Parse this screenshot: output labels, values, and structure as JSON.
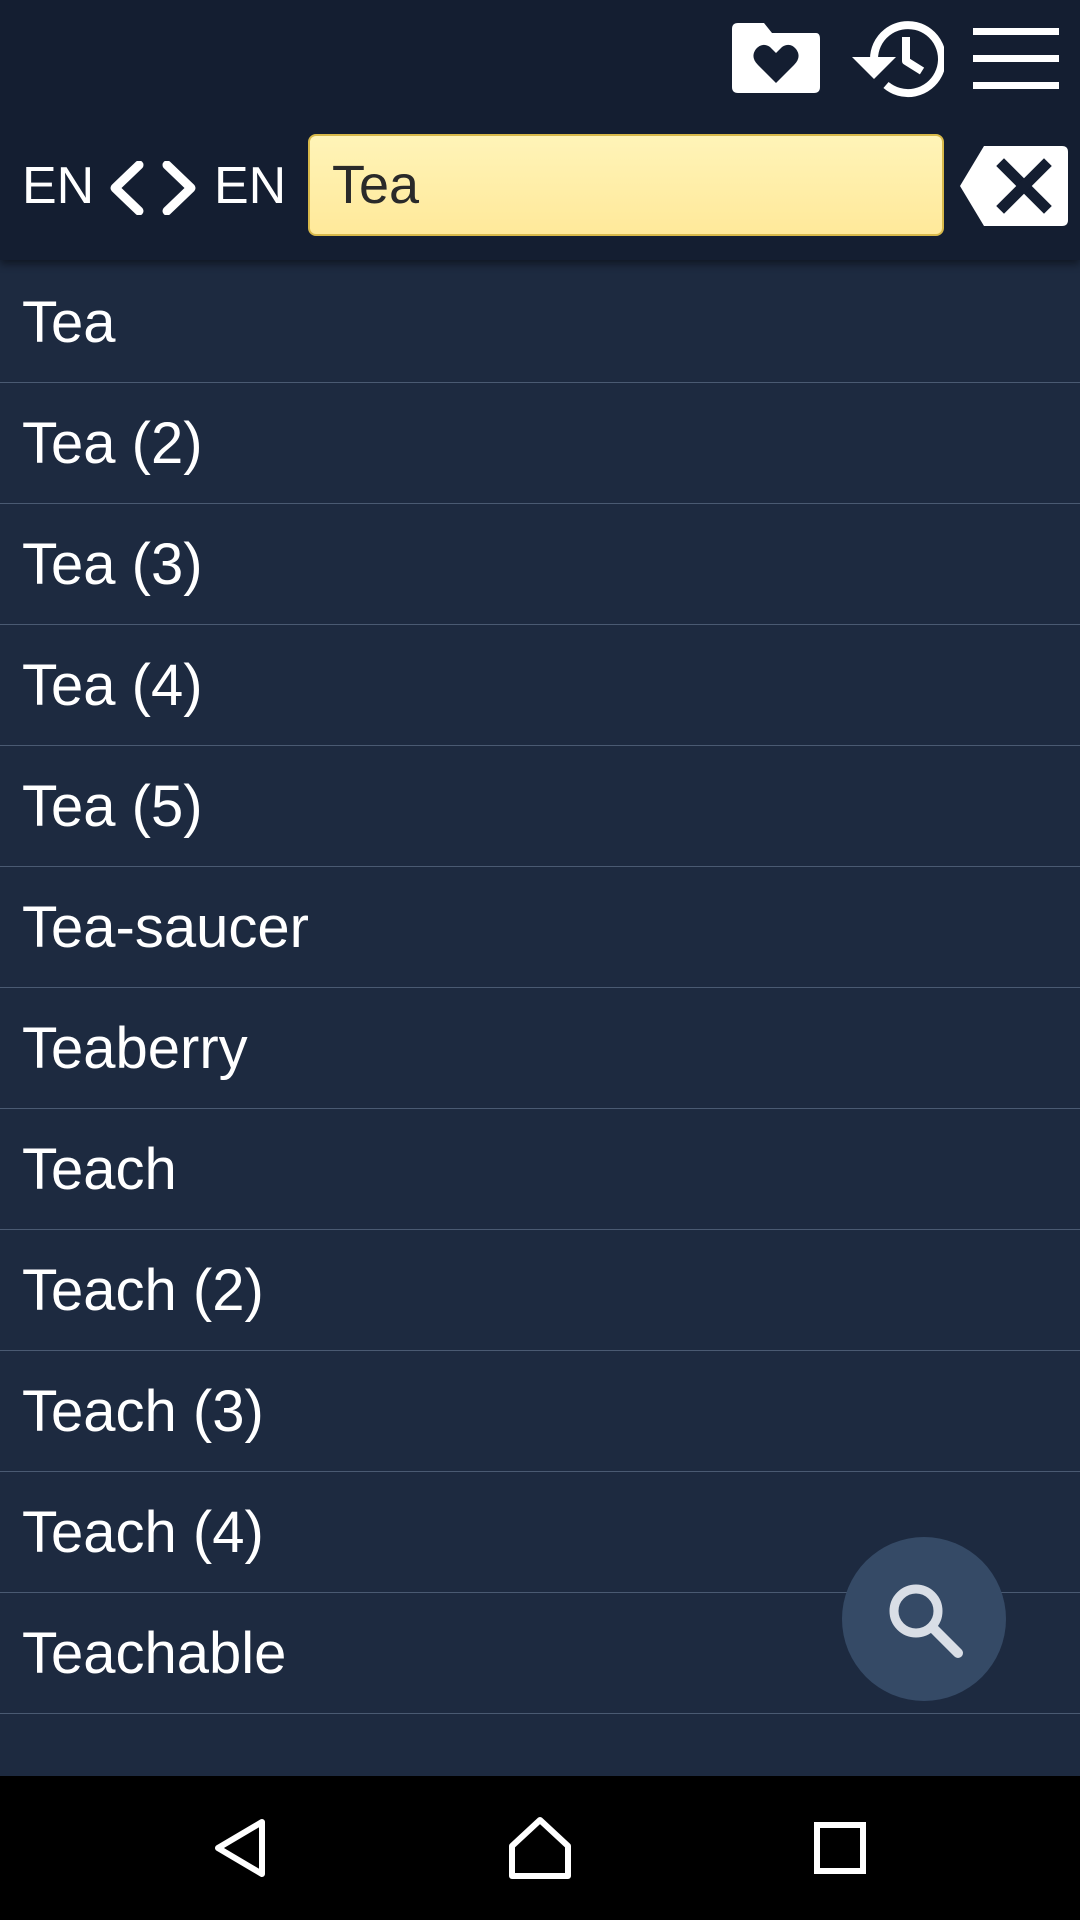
{
  "header": {
    "favorites_icon": "folder-heart-icon",
    "history_icon": "history-icon",
    "menu_icon": "hamburger-menu-icon",
    "source_lang": "EN",
    "target_lang": "EN",
    "search_value": "Tea",
    "clear_icon": "backspace-clear-icon"
  },
  "list": {
    "items": [
      "Tea",
      "Tea (2)",
      "Tea (3)",
      "Tea (4)",
      "Tea (5)",
      "Tea-saucer",
      "Teaberry",
      "Teach",
      "Teach (2)",
      "Teach (3)",
      "Teach (4)",
      "Teachable"
    ]
  },
  "fab": {
    "icon": "search-icon"
  },
  "navbar": {
    "back_icon": "back-triangle-icon",
    "home_icon": "home-icon",
    "recents_icon": "recents-square-icon"
  },
  "colors": {
    "header_bg": "#141e31",
    "list_bg": "#1d2a40",
    "search_bg": "#ffef9f",
    "fab_bg": "#354a66",
    "divider": "#4a5a72"
  }
}
